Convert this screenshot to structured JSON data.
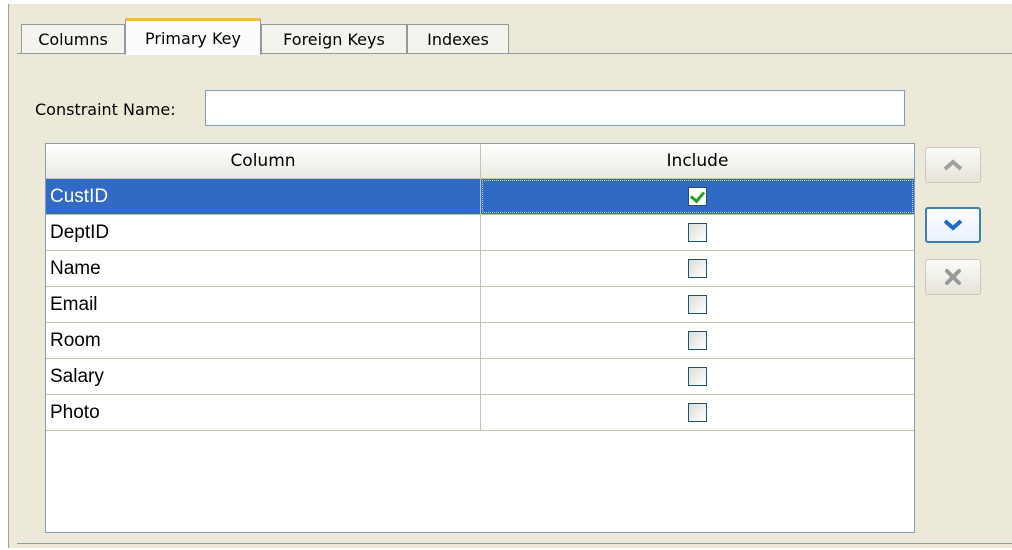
{
  "tabs": [
    {
      "label": "Columns",
      "active": false
    },
    {
      "label": "Primary Key",
      "active": true
    },
    {
      "label": "Foreign Keys",
      "active": false
    },
    {
      "label": "Indexes",
      "active": false
    }
  ],
  "constraint": {
    "label": "Constraint Name:",
    "value": "",
    "placeholder": ""
  },
  "table": {
    "headers": {
      "column": "Column",
      "include": "Include"
    },
    "rows": [
      {
        "name": "CustID",
        "include": true,
        "selected": true
      },
      {
        "name": "DeptID",
        "include": false,
        "selected": false
      },
      {
        "name": "Name",
        "include": false,
        "selected": false
      },
      {
        "name": "Email",
        "include": false,
        "selected": false
      },
      {
        "name": "Room",
        "include": false,
        "selected": false
      },
      {
        "name": "Salary",
        "include": false,
        "selected": false
      },
      {
        "name": "Photo",
        "include": false,
        "selected": false
      }
    ]
  },
  "buttons": {
    "move_up_icon": "chevron-up-icon",
    "move_down_icon": "chevron-down-icon",
    "remove_icon": "x-icon"
  },
  "colors": {
    "selection": "#316ac5",
    "active_tab_accent": "#f5b948",
    "check": "#21a121"
  }
}
